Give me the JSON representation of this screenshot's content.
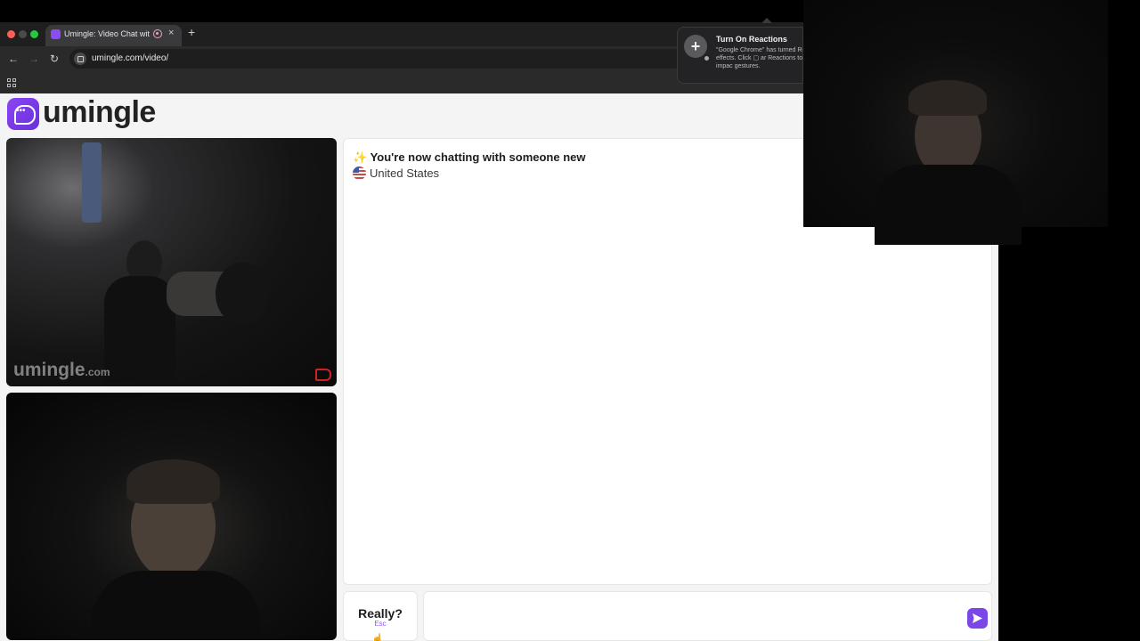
{
  "browser": {
    "tab_title": "Umingle: Video Chat with",
    "tab_close": "×",
    "new_tab": "+",
    "url": "umingle.com/video/",
    "nav_back": "←",
    "nav_forward": "→",
    "nav_reload": "↻"
  },
  "reactions_popup": {
    "title": "Turn On Reactions",
    "body": "\"Google Chrome\" has turned Reaction effects. Click ▢ ar Reactions to add more impac gestures.",
    "plus": "+"
  },
  "site": {
    "logo_text": "umingle"
  },
  "stranger_video": {
    "watermark": "umingle",
    "watermark_suffix": ".com"
  },
  "chat": {
    "status_icon": "✨",
    "status": "You're now chatting with someone new",
    "country": "United States"
  },
  "controls": {
    "skip_label": "Really?",
    "skip_key": "Esc",
    "message_value": "",
    "message_placeholder": ""
  },
  "colors": {
    "accent": "#7b47e8",
    "page_bg": "#f4f4f5",
    "chrome_bg": "#2a2a2b"
  }
}
